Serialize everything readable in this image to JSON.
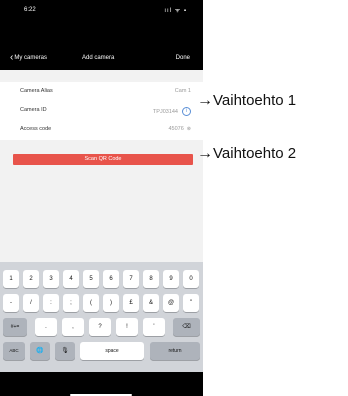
{
  "status_bar": {
    "time": "6:22",
    "icons": "ııl ᯤ ▪"
  },
  "nav": {
    "back_label": "My cameras",
    "title": "Add camera",
    "done_label": "Done"
  },
  "form": {
    "rows": [
      {
        "label": "Camera Alias",
        "value": "Cam 1"
      },
      {
        "label": "Camera ID",
        "value": "TPJ03144"
      },
      {
        "label": "Access code",
        "value": "45076"
      }
    ],
    "info_glyph": "i",
    "clear_glyph": "⊗"
  },
  "scan_button": {
    "label": "Scan QR Code"
  },
  "keyboard": {
    "row1": [
      "1",
      "2",
      "3",
      "4",
      "5",
      "6",
      "7",
      "8",
      "9",
      "0"
    ],
    "row2": [
      "-",
      "/",
      ":",
      ";",
      "(",
      ")",
      "£",
      "&",
      "@",
      "\""
    ],
    "row3_left": "#+=",
    "row3": [
      ".",
      ",",
      "?",
      "!",
      "'"
    ],
    "row3_right": "⌫",
    "abc": "ABC",
    "globe": "🌐",
    "mic": "🎙",
    "space": "space",
    "return": "return"
  },
  "annotations": [
    {
      "arrow": "→",
      "text": "Vaihtoehto  1"
    },
    {
      "arrow": "→",
      "text": "Vaihtoehto  2"
    }
  ]
}
